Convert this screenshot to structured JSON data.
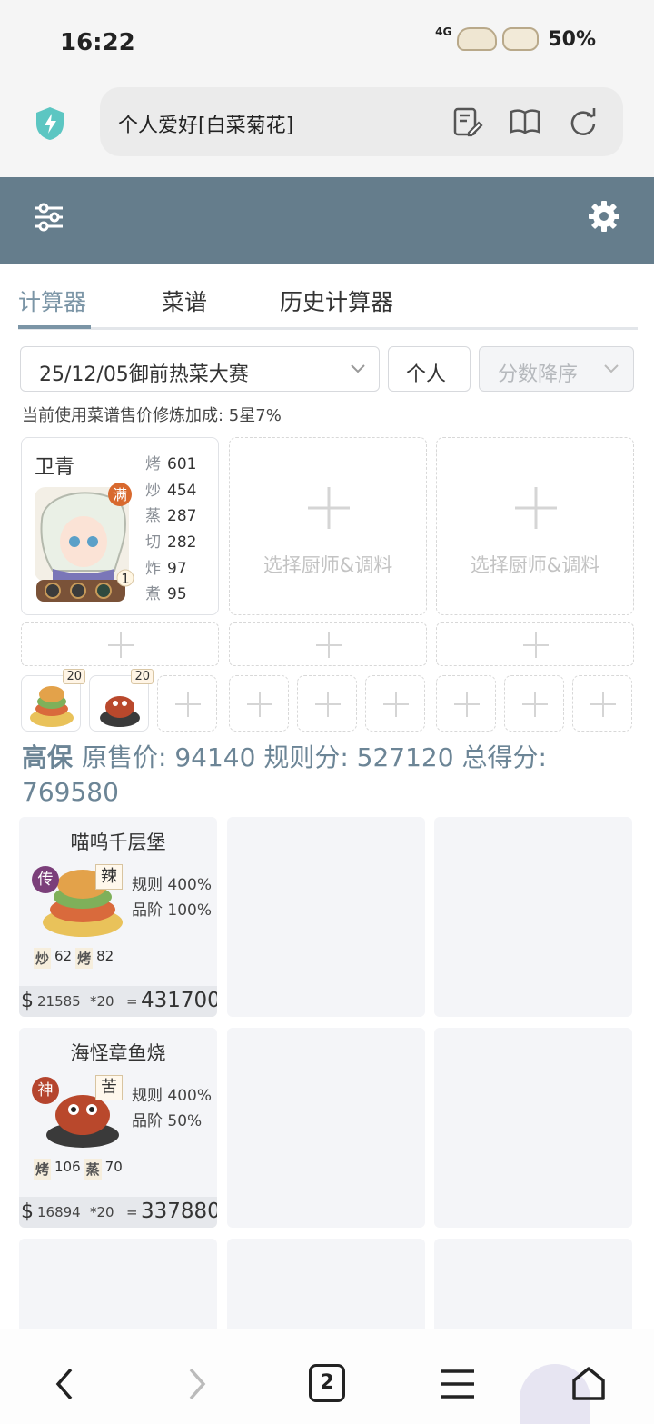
{
  "status": {
    "time": "16:22",
    "network": "4G",
    "battery": "50%"
  },
  "browser": {
    "address_text": "个人爱好[白菜菊花]",
    "tab_count": "2"
  },
  "tabs": [
    "计算器",
    "菜谱",
    "历史计算器"
  ],
  "controls": {
    "contest": "25/12/05御前热菜大赛",
    "mode": "个人",
    "sort": "分数降序"
  },
  "note": "当前使用菜谱售价修炼加成: 5星7%",
  "chef": {
    "name": "卫青",
    "full_badge": "满",
    "level": "1",
    "stats": [
      {
        "k": "烤",
        "v": "601"
      },
      {
        "k": "炒",
        "v": "454"
      },
      {
        "k": "蒸",
        "v": "287"
      },
      {
        "k": "切",
        "v": "282"
      },
      {
        "k": "炸",
        "v": "97"
      },
      {
        "k": "煮",
        "v": "95"
      }
    ]
  },
  "empty_chef_label": "选择厨师&调料",
  "dish_slots": [
    {
      "count": "20"
    },
    {
      "count": "20"
    }
  ],
  "summary": {
    "label": "高保",
    "text": "原售价: 94140 规则分: 527120 总得分: 769580"
  },
  "recipes": [
    {
      "title": "喵呜千层堡",
      "rarity": "传",
      "rarity_color": "#7b3f7a",
      "taste": "辣",
      "rule": "规则 400%",
      "grade": "品阶 100%",
      "skills": [
        {
          "k": "炒",
          "v": "62"
        },
        {
          "k": "烤",
          "v": "82"
        }
      ],
      "price": "21585",
      "mult": "*20",
      "eq": "=",
      "total": "431700"
    },
    {
      "title": "海怪章鱼烧",
      "rarity": "神",
      "rarity_color": "#b5452e",
      "taste": "苦",
      "rule": "规则 400%",
      "grade": "品阶 50%",
      "skills": [
        {
          "k": "烤",
          "v": "106"
        },
        {
          "k": "蒸",
          "v": "70"
        }
      ],
      "price": "16894",
      "mult": "*20",
      "eq": "=",
      "total": "337880"
    }
  ],
  "colors": {
    "header": "#657d8c",
    "accent": "#7b95a6",
    "card_bg": "#f4f5f8"
  }
}
